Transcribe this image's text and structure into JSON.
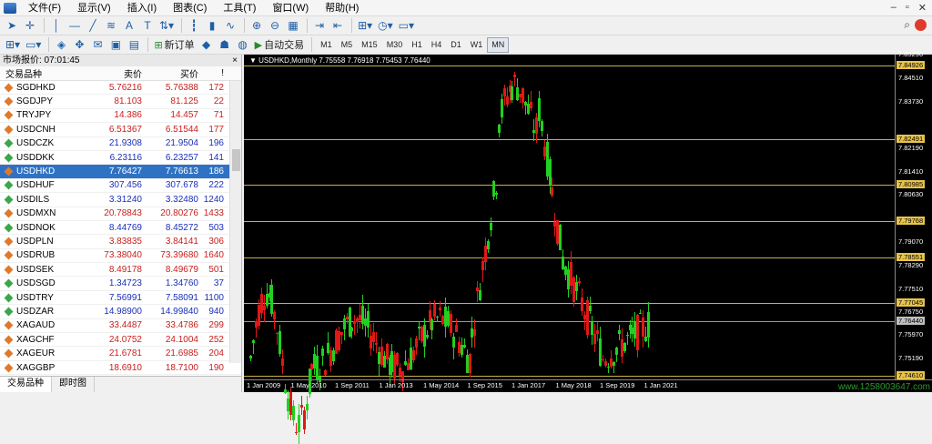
{
  "menubar": {
    "items": [
      "文件(F)",
      "显示(V)",
      "插入(I)",
      "图表(C)",
      "工具(T)",
      "窗口(W)",
      "帮助(H)"
    ]
  },
  "toolbar": {
    "new_order_label": "新订单",
    "auto_trading_label": "自动交易",
    "timeframes": [
      "M1",
      "M5",
      "M15",
      "M30",
      "H1",
      "H4",
      "D1",
      "W1",
      "MN"
    ],
    "active_timeframe": "MN"
  },
  "market_watch": {
    "title": "市场报价: 07:01:45",
    "close": "×",
    "columns": {
      "symbol": "交易品种",
      "bid": "卖价",
      "ask": "买价",
      "spread": "!"
    },
    "rows": [
      {
        "symbol": "SGDHKD",
        "bid": "5.76216",
        "ask": "5.76388",
        "spread": "172",
        "trend": "down",
        "color": "red"
      },
      {
        "symbol": "SGDJPY",
        "bid": "81.103",
        "ask": "81.125",
        "spread": "22",
        "trend": "down",
        "color": "red"
      },
      {
        "symbol": "TRYJPY",
        "bid": "14.386",
        "ask": "14.457",
        "spread": "71",
        "trend": "down",
        "color": "red"
      },
      {
        "symbol": "USDCNH",
        "bid": "6.51367",
        "ask": "6.51544",
        "spread": "177",
        "trend": "down",
        "color": "red"
      },
      {
        "symbol": "USDCZK",
        "bid": "21.9308",
        "ask": "21.9504",
        "spread": "196",
        "trend": "up",
        "color": "blue"
      },
      {
        "symbol": "USDDKK",
        "bid": "6.23116",
        "ask": "6.23257",
        "spread": "141",
        "trend": "up",
        "color": "blue"
      },
      {
        "symbol": "USDHKD",
        "bid": "7.76427",
        "ask": "7.76613",
        "spread": "186",
        "trend": "down",
        "color": "red",
        "selected": true
      },
      {
        "symbol": "USDHUF",
        "bid": "307.456",
        "ask": "307.678",
        "spread": "222",
        "trend": "up",
        "color": "blue"
      },
      {
        "symbol": "USDILS",
        "bid": "3.31240",
        "ask": "3.32480",
        "spread": "1240",
        "trend": "up",
        "color": "blue"
      },
      {
        "symbol": "USDMXN",
        "bid": "20.78843",
        "ask": "20.80276",
        "spread": "1433",
        "trend": "down",
        "color": "red"
      },
      {
        "symbol": "USDNOK",
        "bid": "8.44769",
        "ask": "8.45272",
        "spread": "503",
        "trend": "up",
        "color": "blue"
      },
      {
        "symbol": "USDPLN",
        "bid": "3.83835",
        "ask": "3.84141",
        "spread": "306",
        "trend": "down",
        "color": "red"
      },
      {
        "symbol": "USDRUB",
        "bid": "73.38040",
        "ask": "73.39680",
        "spread": "1640",
        "trend": "down",
        "color": "red"
      },
      {
        "symbol": "USDSEK",
        "bid": "8.49178",
        "ask": "8.49679",
        "spread": "501",
        "trend": "down",
        "color": "red"
      },
      {
        "symbol": "USDSGD",
        "bid": "1.34723",
        "ask": "1.34760",
        "spread": "37",
        "trend": "up",
        "color": "blue"
      },
      {
        "symbol": "USDTRY",
        "bid": "7.56991",
        "ask": "7.58091",
        "spread": "1100",
        "trend": "up",
        "color": "blue"
      },
      {
        "symbol": "USDZAR",
        "bid": "14.98900",
        "ask": "14.99840",
        "spread": "940",
        "trend": "up",
        "color": "blue"
      },
      {
        "symbol": "XAGAUD",
        "bid": "33.4487",
        "ask": "33.4786",
        "spread": "299",
        "trend": "down",
        "color": "red"
      },
      {
        "symbol": "XAGCHF",
        "bid": "24.0752",
        "ask": "24.1004",
        "spread": "252",
        "trend": "down",
        "color": "red"
      },
      {
        "symbol": "XAGEUR",
        "bid": "21.6781",
        "ask": "21.6985",
        "spread": "204",
        "trend": "down",
        "color": "red"
      },
      {
        "symbol": "XAGGBP",
        "bid": "18.6910",
        "ask": "18.7100",
        "spread": "190",
        "trend": "down",
        "color": "red"
      }
    ],
    "tabs": [
      "交易品种",
      "即时图"
    ],
    "active_tab": "交易品种"
  },
  "chart_data": {
    "type": "candlestick",
    "title": "USDHKD,Monthly  7.75558 7.76918 7.75453 7.76440",
    "ylim": [
      7.745,
      7.853
    ],
    "y_ticks": [
      "7.85290",
      "7.84510",
      "7.83730",
      "7.82190",
      "7.81410",
      "7.80630",
      "7.79070",
      "7.78290",
      "7.77510",
      "7.76750",
      "7.75970",
      "7.75190"
    ],
    "price_levels": [
      {
        "value": "7.84926",
        "style": "gold"
      },
      {
        "value": "7.82491",
        "style": "gold"
      },
      {
        "value": "7.80985",
        "style": "gold"
      },
      {
        "value": "7.79768",
        "style": "gold"
      },
      {
        "value": "7.78551",
        "style": "gold"
      },
      {
        "value": "7.77045",
        "style": "gold"
      },
      {
        "value": "7.76440",
        "style": "gray"
      },
      {
        "value": "7.74610",
        "style": "gold"
      }
    ],
    "x_ticks": [
      "1 Jan 2009",
      "1 May 2010",
      "1 Sep 2011",
      "1 Jan 2013",
      "1 May 2014",
      "1 Sep 2015",
      "1 Jan 2017",
      "1 May 2018",
      "1 Sep 2019",
      "1 Jan 2021"
    ],
    "colors": {
      "bull": "#22d020",
      "bear": "#e01818",
      "level": "#c8b048",
      "current": "#9a9a9a"
    }
  },
  "watermark": "www.1258003647.com"
}
